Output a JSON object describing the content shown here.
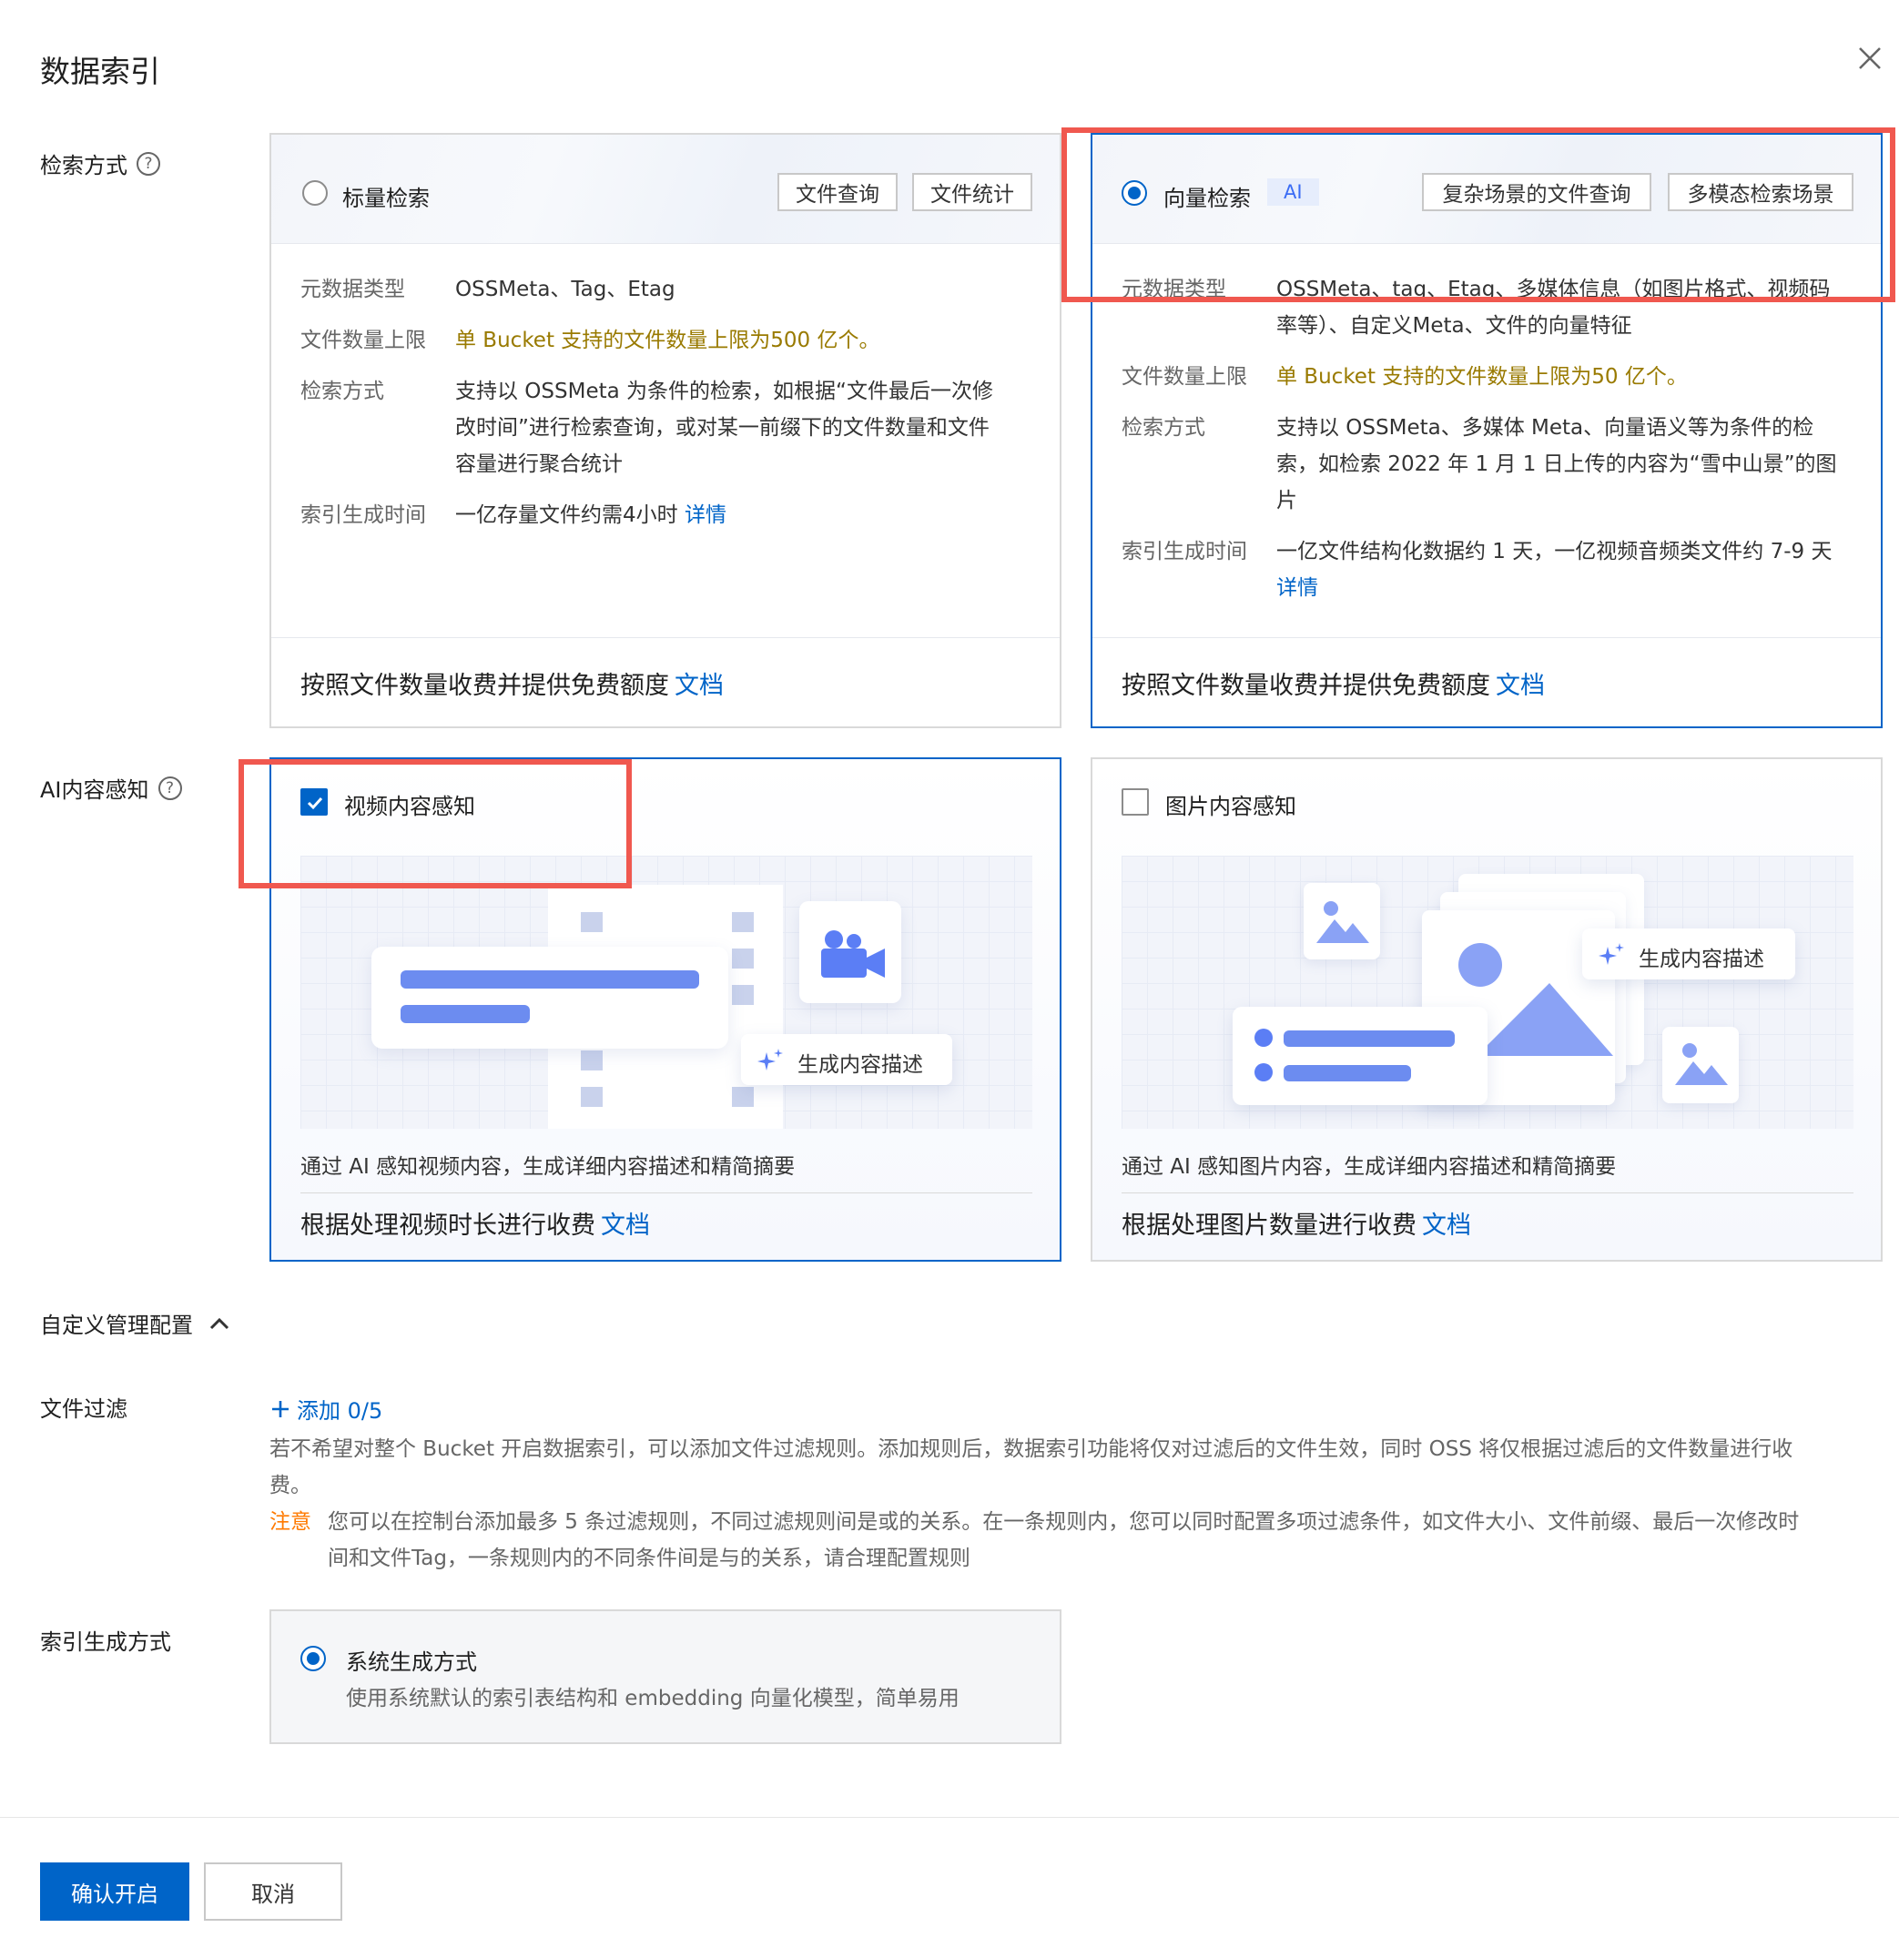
{
  "dialog": {
    "title": "数据索引"
  },
  "labels": {
    "search_mode": "检索方式",
    "ai_perception": "AI内容感知",
    "custom_config": "自定义管理配置",
    "file_filter": "文件过滤",
    "index_gen_mode": "索引生成方式"
  },
  "scalar": {
    "title": "标量检索",
    "tags": [
      "文件查询",
      "文件统计"
    ],
    "rows": [
      {
        "k": "元数据类型",
        "v": "OSSMeta、Tag、Etag"
      },
      {
        "k": "文件数量上限",
        "v": "单 Bucket 支持的文件数量上限为500 亿个。"
      },
      {
        "k": "检索方式",
        "v1": "支持以 OSSMeta 为条件的检索，如根据“文件最后一次修",
        "v2": "改时间”进行检索查询，或对某一前缀下的文件数量和文件",
        "v3": "容量进行聚合统计"
      },
      {
        "k": "索引生成时间",
        "v": "一亿存量文件约需4小时",
        "link": "详情"
      }
    ],
    "footer": "按照文件数量收费并提供免费额度",
    "footer_link": "文档"
  },
  "vector": {
    "title": "向量检索",
    "ai_tag": "AI",
    "tags": [
      "复杂场景的文件查询",
      "多模态检索场景"
    ],
    "rows": [
      {
        "k": "元数据类型",
        "v1": "OSSMeta、tag、Etag、多媒体信息（如图片格式、视频码",
        "v2": "率等）、自定义Meta、文件的向量特征"
      },
      {
        "k": "文件数量上限",
        "v": "单 Bucket 支持的文件数量上限为50 亿个。"
      },
      {
        "k": "检索方式",
        "v1": "支持以 OSSMeta、多媒体 Meta、向量语义等为条件的检",
        "v2": "索，如检索 2022 年 1 月 1 日上传的内容为“雪中山景”的图",
        "v3": "片"
      },
      {
        "k": "索引生成时间",
        "v": "一亿文件结构化数据约 1 天，一亿视频音频类文件约 7-9 天",
        "link": "详情"
      }
    ],
    "footer": "按照文件数量收费并提供免费额度",
    "footer_link": "文档"
  },
  "video_ai": {
    "title": "视频内容感知",
    "badge": "生成内容描述",
    "desc": "通过 AI 感知视频内容，生成详细内容描述和精简摘要",
    "footer": "根据处理视频时长进行收费",
    "footer_link": "文档"
  },
  "image_ai": {
    "title": "图片内容感知",
    "badge": "生成内容描述",
    "desc": "通过 AI 感知图片内容，生成详细内容描述和精简摘要",
    "footer": "根据处理图片数量进行收费",
    "footer_link": "文档"
  },
  "filter": {
    "add_label": "添加 0/5",
    "desc1": "若不希望对整个 Bucket 开启数据索引，可以添加文件过滤规则。添加规则后，数据索引功能将仅对过滤后的文件生效，同时 OSS 将仅根据过滤后的文件数量进行收",
    "desc2": "费。",
    "note_label": "注意",
    "note1": "您可以在控制台添加最多 5 条过滤规则，不同过滤规则间是或的关系。在一条规则内，您可以同时配置多项过滤条件，如文件大小、文件前缀、最后一次修改时",
    "note2": "间和文件Tag，一条规则内的不同条件间是与的关系，请合理配置规则"
  },
  "gen": {
    "title": "系统生成方式",
    "desc": "使用系统默认的索引表结构和 embedding 向量化模型，简单易用"
  },
  "buttons": {
    "confirm": "确认开启",
    "cancel": "取消"
  },
  "colors": {
    "primary": "#0064c8",
    "highlight": "#f0584f",
    "warn": "#997a00",
    "note": "#ff7a00"
  }
}
